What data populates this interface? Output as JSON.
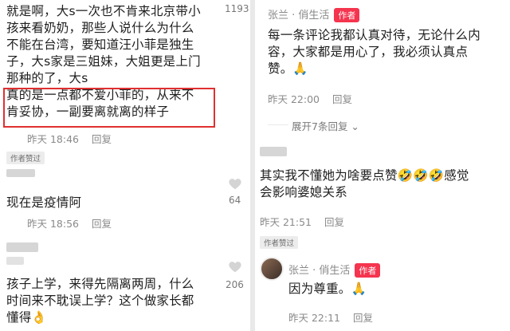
{
  "left": {
    "comment1": {
      "lines": [
        "就是啊，大s一次也不肯来北京带小",
        "孩来看奶奶，那些人说什么为什么",
        "不能在台湾，要知道汪小菲是独生",
        "子，大s家是三姐妹，大姐更是上门",
        "那种的了，大s",
        "真的是一点都不爱小菲的，从来不",
        "肯妥协，一副要离就离的样子"
      ],
      "time": "昨天 18:46",
      "reply": "回复",
      "badge": "作者赞过",
      "likes": "1193"
    },
    "comment2": {
      "text": "现在是疫情阿",
      "time": "昨天 18:56",
      "reply": "回复",
      "likes": "64"
    },
    "comment3": {
      "lines": [
        "孩子上学，来得先隔离两周，什么",
        "时间来不耽误上学？这个做家长都",
        "懂得👌"
      ],
      "likes": "206"
    }
  },
  "right": {
    "reply1": {
      "author": "张兰 · 俏生活",
      "tag": "作者",
      "lines": [
        "每一条评论我都认真对待，无论什么内",
        "容，大家都是用心了，我必须认真点",
        "赞。🙏"
      ],
      "time": "昨天 22:00",
      "reply": "回复"
    },
    "expand": "展开7条回复 ⌄",
    "comment2": {
      "lines": [
        "其实我不懂她为啥要点赞🤣🤣🤣感觉",
        "会影响婆媳关系"
      ],
      "time": "昨天 21:51",
      "reply": "回复",
      "badge": "作者赞过"
    },
    "reply2": {
      "author": "张兰 · 俏生活",
      "tag": "作者",
      "text": "因为尊重。🙏",
      "time": "昨天 22:11",
      "reply": "回复"
    }
  }
}
